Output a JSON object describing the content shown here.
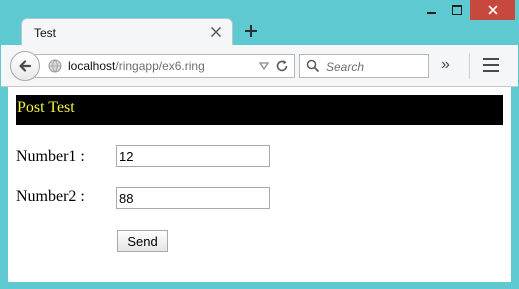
{
  "window": {
    "accent_color": "#5fc9d2",
    "close_color": "#c7483d"
  },
  "tab": {
    "title": "Test"
  },
  "nav": {
    "url_host": "localhost",
    "url_path": "/ringapp/ex6.ring",
    "search_placeholder": "Search",
    "overflow_label": "»"
  },
  "page": {
    "banner_title": "Post Test",
    "banner_bg": "#000000",
    "banner_fg": "#f2f23a",
    "fields": [
      {
        "label": "Number1 :",
        "value": "12"
      },
      {
        "label": "Number2 :",
        "value": "88"
      }
    ],
    "submit_label": "Send"
  }
}
